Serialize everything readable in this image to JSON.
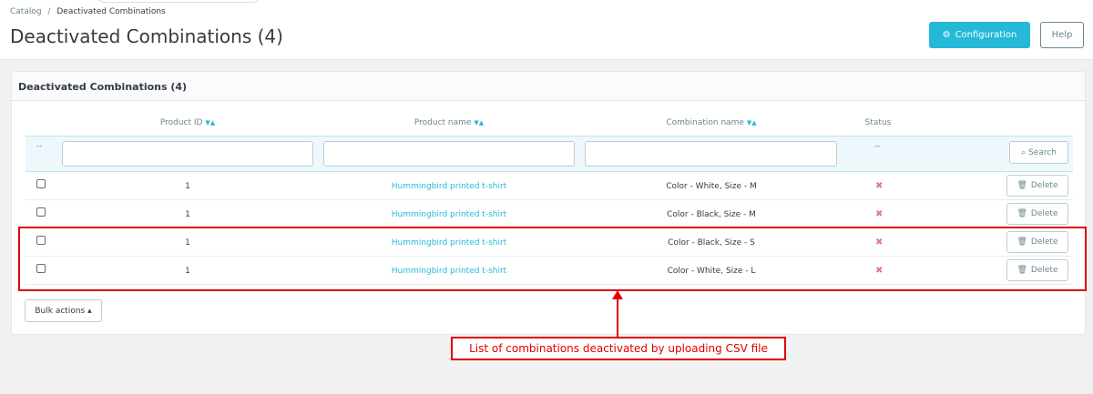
{
  "breadcrumb": {
    "parent": "Catalog",
    "separator": "/",
    "current": "Deactivated Combinations"
  },
  "page_title": "Deactivated Combinations (4)",
  "toolbar": {
    "configuration": "Configuration",
    "help": "Help"
  },
  "panel": {
    "title": "Deactivated Combinations (4)"
  },
  "table": {
    "headers": {
      "product_id": "Product ID",
      "product_name": "Product name",
      "combination_name": "Combination name",
      "status": "Status"
    },
    "filter": {
      "dash": "--",
      "status_dash": "--",
      "search": "Search"
    },
    "rows": [
      {
        "id": "1",
        "name": "Hummingbird printed t-shirt",
        "combination": "Color - White, Size - M",
        "status": "✖",
        "action": "Delete"
      },
      {
        "id": "1",
        "name": "Hummingbird printed t-shirt",
        "combination": "Color - Black, Size - M",
        "status": "✖",
        "action": "Delete"
      },
      {
        "id": "1",
        "name": "Hummingbird printed t-shirt",
        "combination": "Color - Black, Size - S",
        "status": "✖",
        "action": "Delete"
      },
      {
        "id": "1",
        "name": "Hummingbird printed t-shirt",
        "combination": "Color - White, Size - L",
        "status": "✖",
        "action": "Delete"
      }
    ]
  },
  "bulk_actions": "Bulk actions ▴",
  "annotation": "List of combinations deactivated by uploading CSV file",
  "colors": {
    "accent": "#25b9d7",
    "annotation": "#e00000"
  }
}
